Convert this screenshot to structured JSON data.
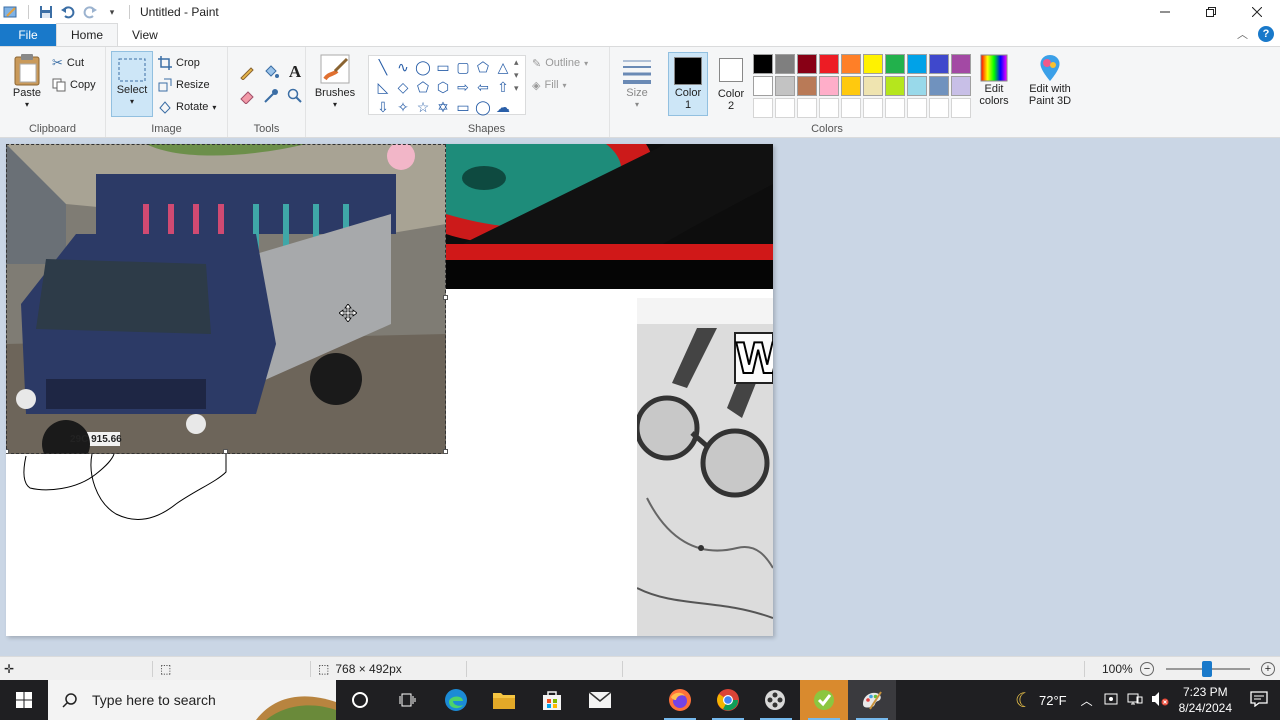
{
  "window": {
    "title": "Untitled - Paint",
    "controls": {
      "minimize": "minimize",
      "maximize": "restore",
      "close": "close"
    }
  },
  "menu": {
    "file_label": "File",
    "tabs": [
      {
        "label": "Home",
        "active": true
      },
      {
        "label": "View",
        "active": false
      }
    ]
  },
  "ribbon": {
    "clipboard": {
      "group_label": "Clipboard",
      "paste_label": "Paste",
      "cut_label": "Cut",
      "copy_label": "Copy"
    },
    "image": {
      "group_label": "Image",
      "select_label": "Select",
      "crop_label": "Crop",
      "resize_label": "Resize",
      "rotate_label": "Rotate"
    },
    "tools": {
      "group_label": "Tools"
    },
    "brushes": {
      "label": "Brushes"
    },
    "shapes": {
      "group_label": "Shapes",
      "outline_label": "Outline",
      "fill_label": "Fill"
    },
    "size": {
      "label": "Size"
    },
    "colors": {
      "group_label": "Colors",
      "color1_label": "Color 1",
      "color2_label": "Color 2",
      "color1": "#000000",
      "color2": "#ffffff",
      "edit_colors_label": "Edit colors",
      "paint3d_label": "Edit with Paint 3D",
      "palette_row1": [
        "#000000",
        "#7f7f7f",
        "#880015",
        "#ed1c24",
        "#ff7f27",
        "#fff200",
        "#22b14c",
        "#00a2e8",
        "#3f48cc",
        "#a349a4"
      ],
      "palette_row2": [
        "#ffffff",
        "#c3c3c3",
        "#b97a57",
        "#ffaec9",
        "#ffc90e",
        "#efe4b0",
        "#b5e61d",
        "#99d9ea",
        "#7092be",
        "#c8bfe7"
      ]
    }
  },
  "canvas": {
    "plate_text": "29C 915.66",
    "meme_text": "W"
  },
  "status": {
    "dimensions": "768 × 492px",
    "zoom": "100%"
  },
  "taskbar": {
    "search_placeholder": "Type here to search",
    "weather": "72°F",
    "time": "7:23 PM",
    "date": "8/24/2024"
  }
}
